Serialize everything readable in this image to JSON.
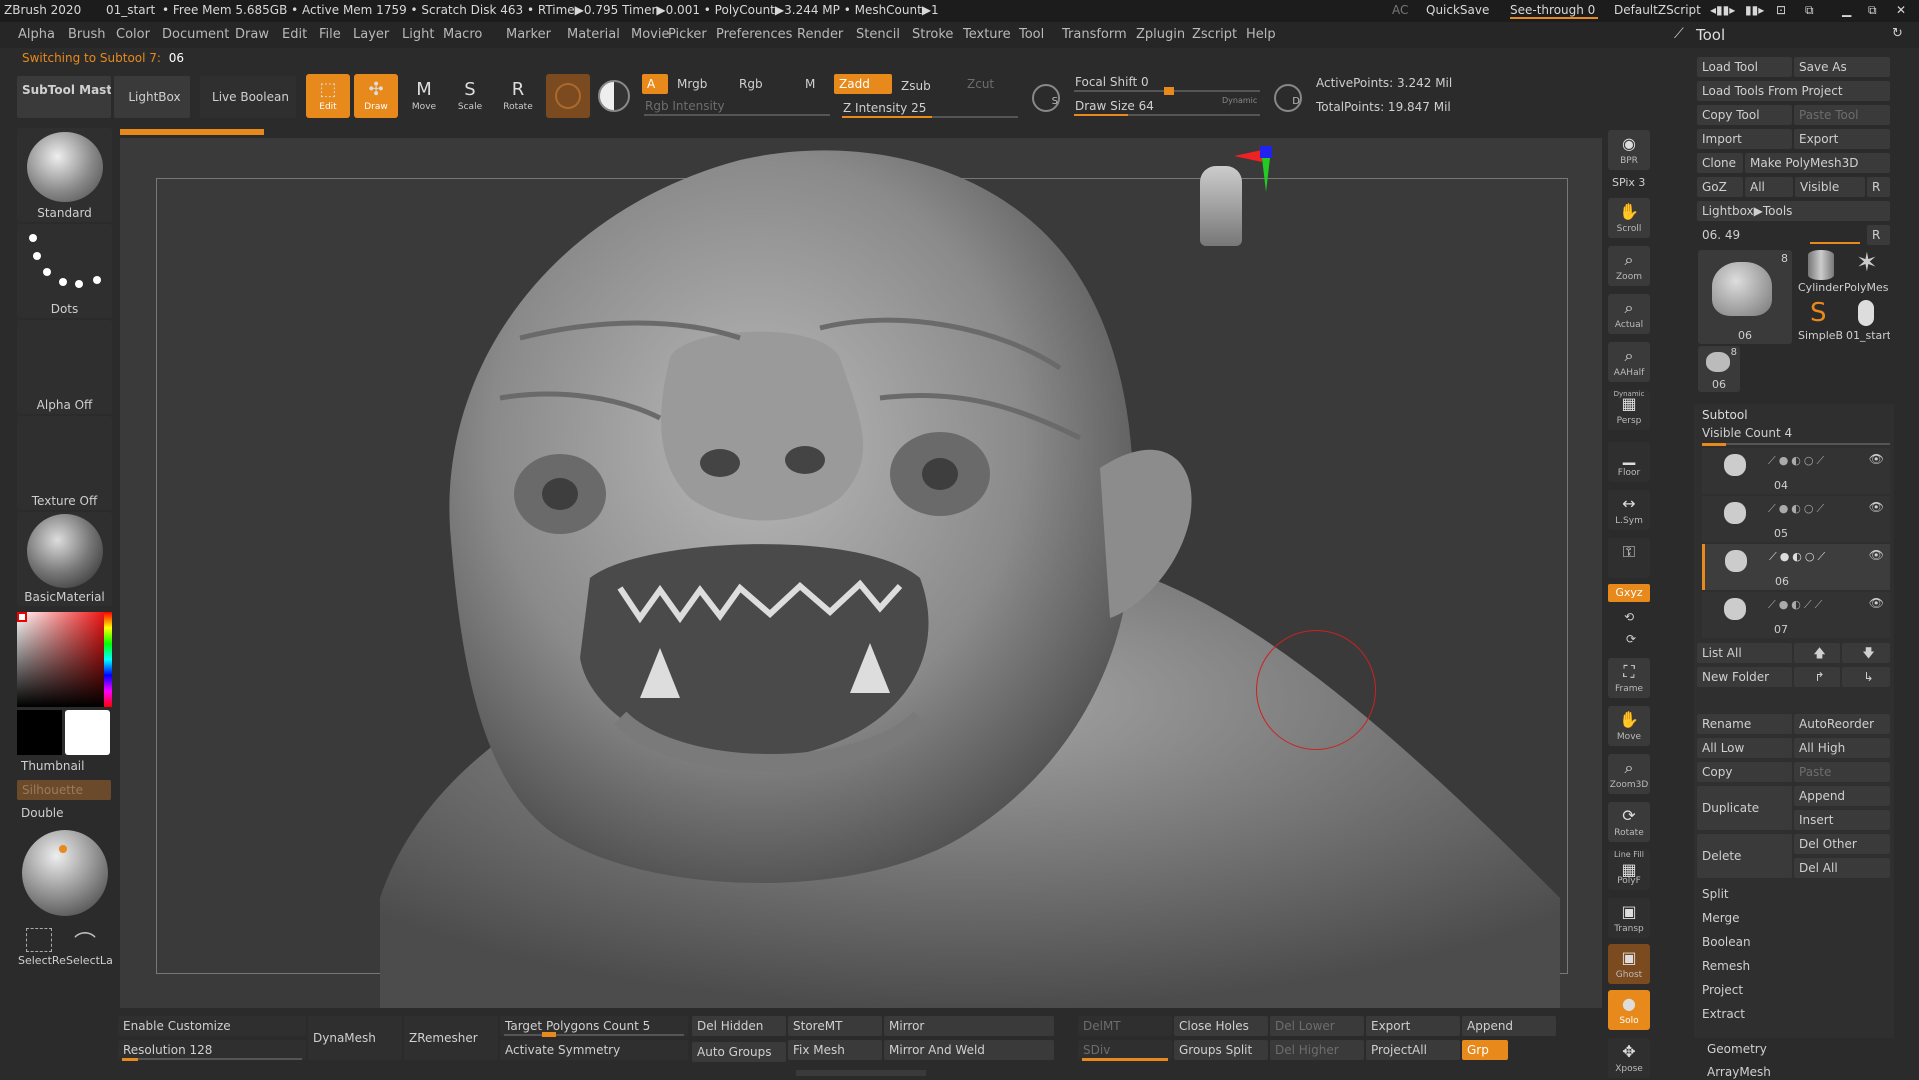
{
  "titlebar": {
    "app": "ZBrush 2020",
    "doc": "01_start",
    "stats": "• Free Mem 5.685GB • Active Mem 1759 • Scratch Disk 463 • RTime▶0.795 Timer▶0.001 • PolyCount▶3.244 MP • MeshCount▶1",
    "ac": "AC",
    "quicksave": "QuickSave",
    "seethrough": "See-through  0",
    "script": "DefaultZScript"
  },
  "menu": [
    "Alpha",
    "Brush",
    "Color",
    "Document",
    "Draw",
    "Edit",
    "File",
    "Layer",
    "Light",
    "Macro",
    "Marker",
    "Material",
    "Movie",
    "Picker",
    "Preferences",
    "Render",
    "Stencil",
    "Stroke",
    "Texture",
    "Tool",
    "Transform",
    "Zplugin",
    "Zscript",
    "Help"
  ],
  "status": {
    "label": "Switching to Subtool 7:",
    "value": "06"
  },
  "toolbar": {
    "subtool_master": "SubTool Master",
    "lightbox": "LightBox",
    "live_boolean": "Live Boolean",
    "edit": "Edit",
    "draw": "Draw",
    "move": "Move",
    "scale": "Scale",
    "rotate": "Rotate",
    "a": "A",
    "mrgb": "Mrgb",
    "rgb": "Rgb",
    "m": "M",
    "zadd": "Zadd",
    "zsub": "Zsub",
    "zcut": "Zcut",
    "rgb_intensity": "Rgb Intensity",
    "z_intensity": "Z Intensity 25",
    "focal_shift": "Focal Shift 0",
    "draw_size": "Draw Size 64",
    "dynamic": "Dynamic",
    "active_points": "ActivePoints: 3.242 Mil",
    "total_points": "TotalPoints: 19.847 Mil",
    "s": "S",
    "d": "D"
  },
  "left": {
    "standard": "Standard",
    "dots": "Dots",
    "alpha_off": "Alpha Off",
    "texture_off": "Texture Off",
    "basic_material": "BasicMaterial",
    "thumbnail": "Thumbnail",
    "silhouette": "Silhouette",
    "double": "Double",
    "select_rect": "SelectRe",
    "select_lasso": "SelectLa"
  },
  "right_tools": [
    {
      "name": "bpr",
      "label": "BPR",
      "icon": "◉"
    },
    {
      "name": "scroll",
      "label": "Scroll",
      "icon": "✋"
    },
    {
      "name": "zoom",
      "label": "Zoom",
      "icon": "🔍"
    },
    {
      "name": "actual",
      "label": "Actual",
      "icon": "⌕"
    },
    {
      "name": "aahalf",
      "label": "AAHalf",
      "icon": "⌕"
    },
    {
      "name": "persp",
      "label": "Persp",
      "icon": "▦"
    },
    {
      "name": "floor",
      "label": "Floor",
      "icon": "▁"
    },
    {
      "name": "lsym",
      "label": "L.Sym",
      "icon": "↔"
    },
    {
      "name": "lock",
      "label": "",
      "icon": "🔒"
    }
  ],
  "right_tools2": [
    {
      "name": "frame",
      "label": "Frame",
      "icon": "⛶"
    },
    {
      "name": "move",
      "label": "Move",
      "icon": "✋"
    },
    {
      "name": "zoom3d",
      "label": "Zoom3D",
      "icon": "⌕"
    },
    {
      "name": "rotate",
      "label": "Rotate",
      "icon": "⟳"
    },
    {
      "name": "polyf",
      "label": "PolyF",
      "icon": "▦"
    },
    {
      "name": "transp",
      "label": "Transp",
      "icon": "▣"
    },
    {
      "name": "ghost",
      "label": "Ghost",
      "icon": "▣"
    },
    {
      "name": "solo",
      "label": "Solo",
      "icon": "●"
    },
    {
      "name": "xpose",
      "label": "Xpose",
      "icon": "✥"
    }
  ],
  "spix": "SPix 3",
  "xyz": "Gxyz",
  "linefill": "Line Fill",
  "dynamic_small": "Dynamic",
  "tool": {
    "title": "Tool",
    "load_tool": "Load Tool",
    "save_as": "Save As",
    "load_from_project": "Load Tools From Project",
    "copy_tool": "Copy Tool",
    "paste_tool": "Paste Tool",
    "import": "Import",
    "export": "Export",
    "clone": "Clone",
    "make_polymesh": "Make PolyMesh3D",
    "goz": "GoZ",
    "all": "All",
    "visible": "Visible",
    "r": "R",
    "lightbox_tools": "Lightbox▶Tools",
    "slider_val": "06. 49",
    "thumb_main": "06",
    "thumb_count": "8",
    "cylinder": "Cylinder",
    "polymesh": "PolyMes",
    "simpleb": "SimpleB",
    "start": "01_start",
    "small_thumb": "06",
    "small_count": "8"
  },
  "subtool": {
    "title": "Subtool",
    "visible_count": "Visible Count 4",
    "items": [
      "04",
      "05",
      "06",
      "07"
    ],
    "list_all": "List All",
    "new_folder": "New Folder",
    "rename": "Rename",
    "autoreorder": "AutoReorder",
    "all_low": "All Low",
    "all_high": "All High",
    "copy": "Copy",
    "paste": "Paste",
    "duplicate": "Duplicate",
    "append": "Append",
    "insert": "Insert",
    "delete": "Delete",
    "del_other": "Del Other",
    "del_all": "Del All",
    "split": "Split",
    "merge": "Merge",
    "boolean": "Boolean",
    "remesh": "Remesh",
    "project": "Project",
    "extract": "Extract",
    "geometry": "Geometry",
    "arraymesh": "ArrayMesh"
  },
  "bottom": {
    "enable_customize": "Enable Customize",
    "resolution": "Resolution 128",
    "dynamesh": "DynaMesh",
    "zremesher": "ZRemesher",
    "target_poly": "Target Polygons Count 5",
    "activate_symmetry": "Activate Symmetry",
    "del_hidden": "Del Hidden",
    "auto_groups": "Auto Groups",
    "storemt": "StoreMT",
    "fix_mesh": "Fix Mesh",
    "mirror": "Mirror",
    "mirror_weld": "Mirror And Weld",
    "delmt": "DelMT",
    "sdiv": "SDiv",
    "close_holes": "Close Holes",
    "groups_split": "Groups Split",
    "del_lower": "Del Lower",
    "del_higher": "Del Higher",
    "export": "Export",
    "projectall": "ProjectAll",
    "append": "Append",
    "grp": "Grp"
  },
  "colors": {
    "accent": "#e8891b",
    "bg": "#2b2b2b",
    "panel": "#3a3a3a",
    "canvas": "#3a3a3a"
  }
}
